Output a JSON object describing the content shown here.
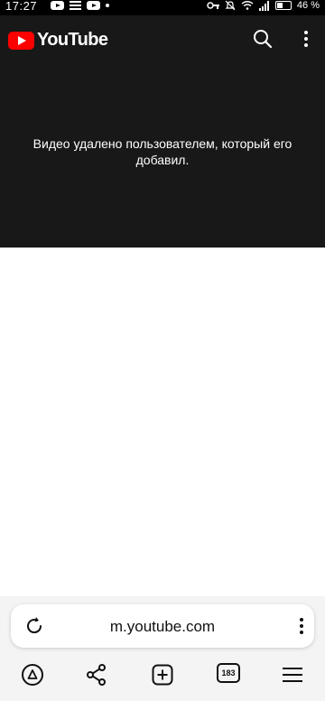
{
  "status_bar": {
    "time": "17:27",
    "battery": "46 %"
  },
  "header": {
    "logo_text": "YouTube"
  },
  "player": {
    "error_message": "Видео удалено пользователем, который его добавил."
  },
  "browser": {
    "url": "m.youtube.com",
    "tab_count": "183"
  },
  "icons": [
    "youtube-notification-icon",
    "news-notification-icon",
    "key-icon",
    "bell-off-icon",
    "wifi-icon",
    "signal-icon",
    "battery-icon",
    "search-icon",
    "more-vert-icon",
    "reload-icon",
    "alice-icon",
    "share-icon",
    "new-tab-icon",
    "tabs-icon",
    "menu-icon"
  ],
  "colors": {
    "youtube_red": "#ff0000",
    "player_bg": "#181818",
    "bottom_bar_bg": "#f4f4f4"
  }
}
